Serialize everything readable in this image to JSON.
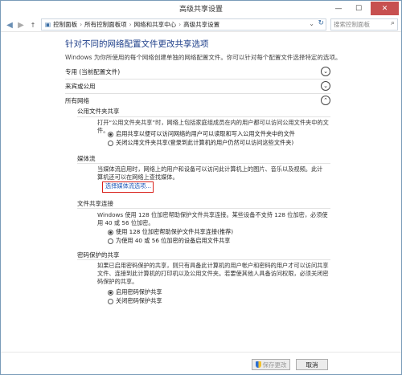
{
  "window": {
    "title": "高级共享设置",
    "min": "—",
    "max": "☐",
    "close": "✕"
  },
  "address": {
    "crumbs": [
      "控制面板",
      "所有控制面板项",
      "网络和共享中心",
      "高级共享设置"
    ],
    "search_placeholder": "搜索控制面板"
  },
  "main": {
    "title": "针对不同的网络配置文件更改共享选项",
    "subtitle": "Windows 为你所使用的每个网络创建单独的网络配置文件。你可以针对每个配置文件选择特定的选项。"
  },
  "profiles": [
    {
      "label": "专用 (当前配置文件)"
    },
    {
      "label": "来宾或公用"
    },
    {
      "label": "所有网络"
    }
  ],
  "public_folder": {
    "heading": "公用文件夹共享",
    "desc": "打开“公用文件夹共享”时，网络上包括家庭组成员在内的用户都可以访问公用文件夹中的文件。",
    "options": [
      {
        "label": "启用共享以便可以访问网络的用户可以读取和写入公用文件夹中的文件",
        "selected": true
      },
      {
        "label": "关闭公用文件夹共享(登录到此计算机的用户仍然可以访问这些文件夹)",
        "selected": false
      }
    ]
  },
  "media": {
    "heading": "媒体流",
    "desc": "当媒体流启用时，网络上的用户和设备可以访问此计算机上的图片、音乐以及视频。此计算机还可以在网络上查找媒体。",
    "link": "选择媒体流选项..."
  },
  "file_conn": {
    "heading": "文件共享连接",
    "desc": "Windows 使用 128 位加密帮助保护文件共享连接。某些设备不支持 128 位加密，必须使用 40 或 56 位加密。",
    "options": [
      {
        "label": "使用 128 位加密帮助保护文件共享连接(推荐)",
        "selected": true
      },
      {
        "label": "为使用 40 或 56 位加密的设备启用文件共享",
        "selected": false
      }
    ]
  },
  "password": {
    "heading": "密码保护的共享",
    "desc": "如果已启用密码保护的共享，则只有具备此计算机的用户帐户和密码的用户才可以访问共享文件、连接到此计算机的打印机以及公用文件夹。若要使其他人具备访问权限，必须关闭密码保护的共享。",
    "options": [
      {
        "label": "启用密码保护共享",
        "selected": true
      },
      {
        "label": "关闭密码保护共享",
        "selected": false
      }
    ]
  },
  "footer": {
    "save": "保存更改",
    "cancel": "取消"
  }
}
